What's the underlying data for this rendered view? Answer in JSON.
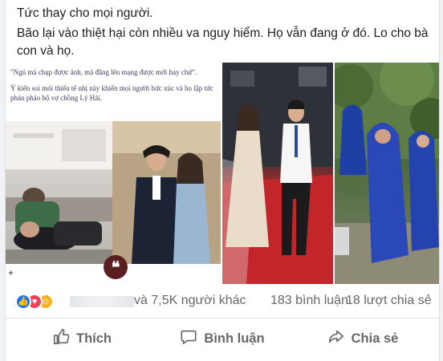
{
  "post": {
    "text_line1": "Tức thay cho mọi người.",
    "text_line2": "Bão lại vào thiệt hại còn nhiều va nguy hiểm. Họ vẫn đang ở đó. Lo cho bà con và họ."
  },
  "media": {
    "quote_line1": "\"Ngủ mà chụp được ảnh, mà đăng lên mạng được mới hay chứ\".",
    "quote_line2": "Ý kiến soi mói thiếu tế nhị này khiến mọi người bức xúc và họ lập tức phản pháo hộ vợ chồng Lý Hải.",
    "quote_badge": "❝",
    "plus_mark": "+"
  },
  "stats": {
    "reactions": [
      "like",
      "love",
      "care"
    ],
    "reaction_count": "và 7,5K người khác",
    "comment_count": "183 bình luận",
    "share_count": "18 lượt chia sẻ"
  },
  "actions": {
    "like_label": "Thích",
    "comment_label": "Bình luận",
    "share_label": "Chia sẻ"
  },
  "colors": {
    "like_blue": "#1877f2",
    "love_red": "#f33e58",
    "care_yellow": "#f7b125",
    "text_secondary": "#65676b"
  }
}
